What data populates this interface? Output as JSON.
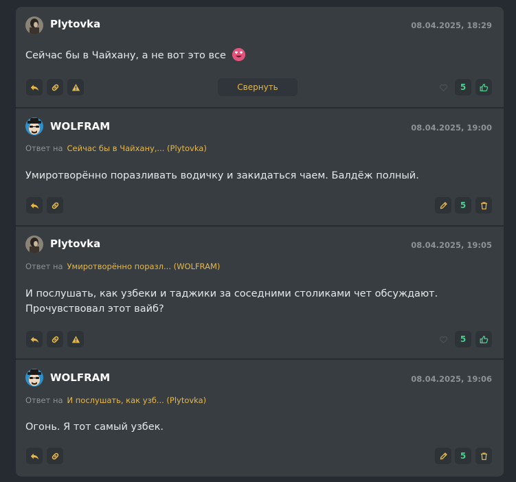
{
  "comments": [
    {
      "author": "Plytovka",
      "date": "08.04.2025, 18:29",
      "text": "Сейчас бы в Чайхану, а не вот это все",
      "likes": "5",
      "collapse_label": "Свернуть"
    },
    {
      "author": "WOLFRAM",
      "date": "08.04.2025, 19:00",
      "reply_prefix": "Ответ на",
      "reply_to": "Сейчас бы в Чайхану,... (Plytovka)",
      "text": "Умиротворённо поразливать водичку и закидаться чаем. Балдёж полный.",
      "likes": "5"
    },
    {
      "author": "Plytovka",
      "date": "08.04.2025, 19:05",
      "reply_prefix": "Ответ на",
      "reply_to": "Умиротворённо поразл... (WOLFRAM)",
      "text_line1": "И послушать, как узбеки и таджики за соседними столиками чет обсуждают.",
      "text_line2": "Прочувствовал этот вайб?",
      "likes": "5"
    },
    {
      "author": "WOLFRAM",
      "date": "08.04.2025, 19:06",
      "reply_prefix": "Ответ на",
      "reply_to": "И послушать, как узб... (Plytovka)",
      "text": "Огонь. Я тот самый узбек.",
      "likes": "5"
    }
  ],
  "colors": {
    "accent": "#e6b84a",
    "likes": "#46d18c",
    "panel": "#373d41",
    "page": "#252b30"
  },
  "icons": {
    "reply": "reply-icon",
    "link": "link-icon",
    "report": "warning-icon",
    "dislike": "heart-icon",
    "like": "thumbs-up-icon",
    "edit": "pencil-icon",
    "delete": "trash-icon"
  }
}
